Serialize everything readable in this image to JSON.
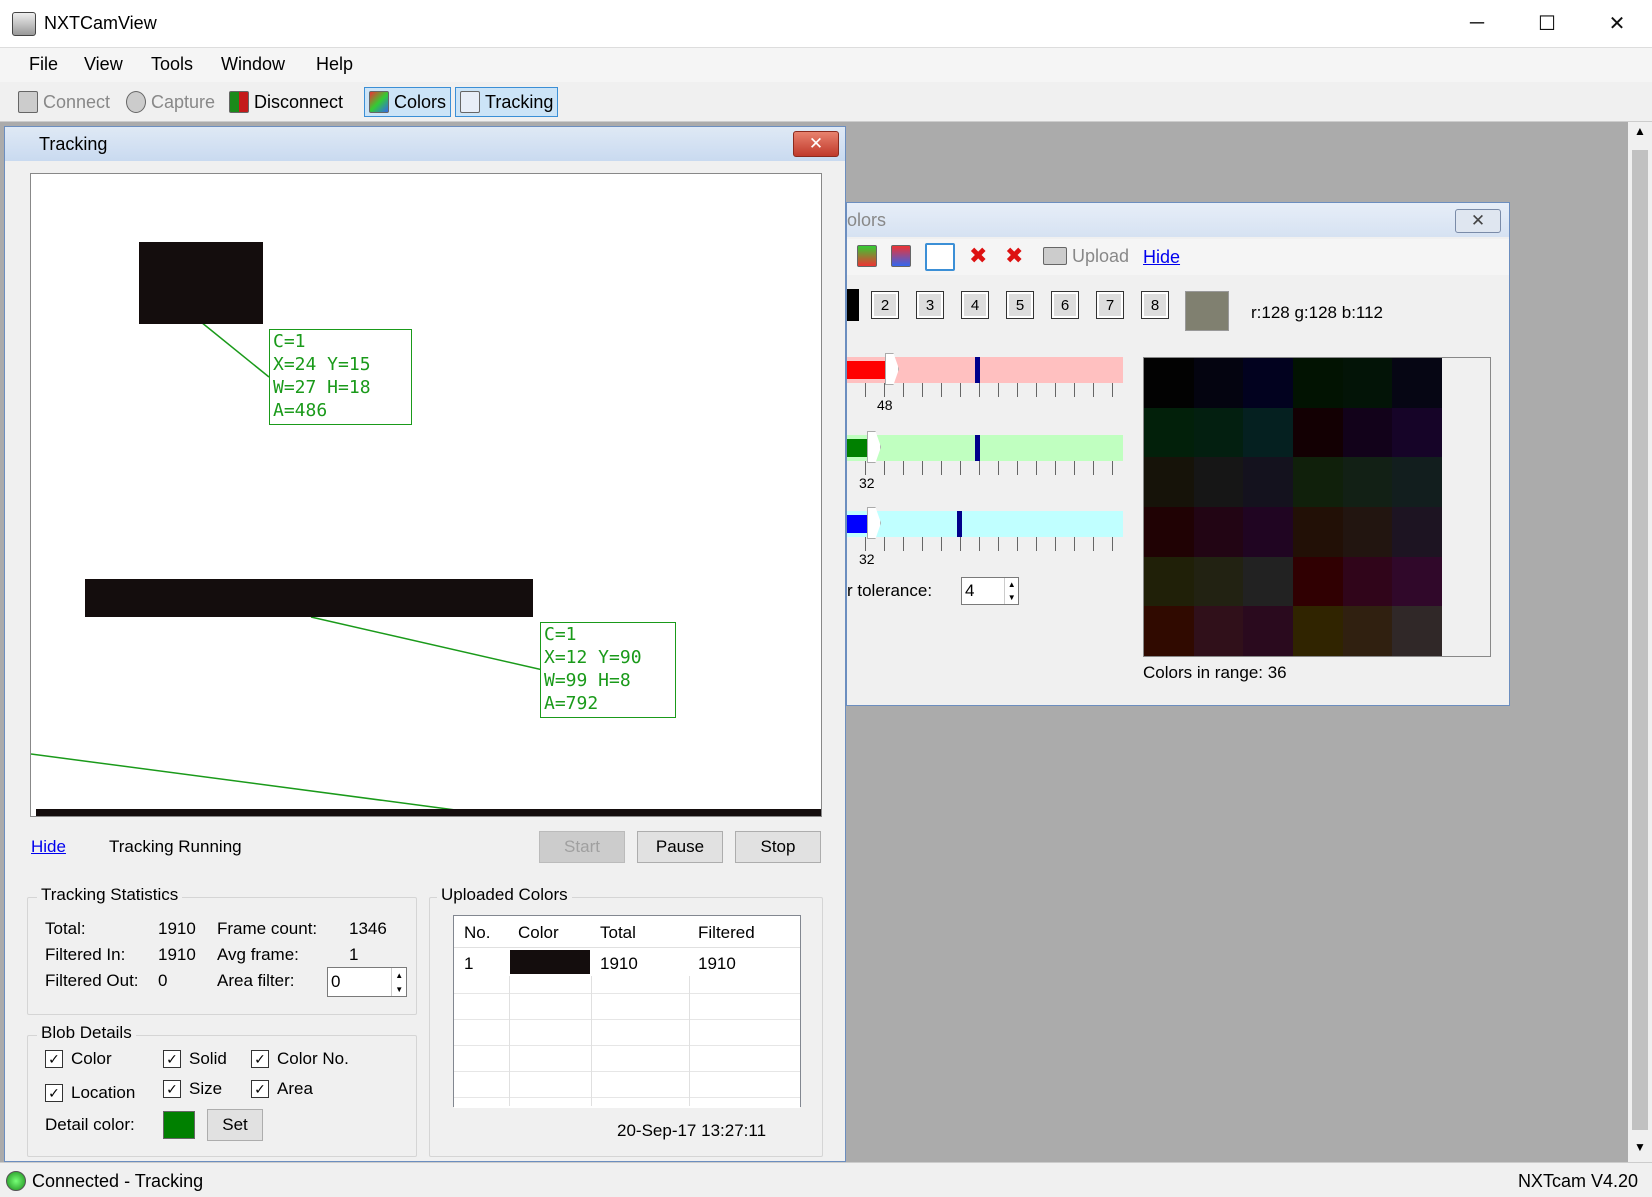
{
  "app": {
    "title": "NXTCamView"
  },
  "window_controls": {
    "minimize": "─",
    "maximize": "☐",
    "close": "✕"
  },
  "menu": [
    "File",
    "View",
    "Tools",
    "Window",
    "Help"
  ],
  "toolbar": {
    "connect": "Connect",
    "capture": "Capture",
    "disconnect": "Disconnect",
    "colors": "Colors",
    "tracking": "Tracking"
  },
  "tracking": {
    "title": "Tracking",
    "hide": "Hide",
    "status": "Tracking Running",
    "start": "Start",
    "pause": "Pause",
    "stop": "Stop",
    "blobs": [
      {
        "label": "C=1\nX=24 Y=15\nW=27 H=18\nA=486"
      },
      {
        "label": "C=1\nX=12 Y=90\nW=99 H=8\nA=792"
      }
    ],
    "stats": {
      "title": "Tracking Statistics",
      "total_label": "Total:",
      "total": "1910",
      "filtered_in_label": "Filtered In:",
      "filtered_in": "1910",
      "filtered_out_label": "Filtered Out:",
      "filtered_out": "0",
      "frame_count_label": "Frame count:",
      "frame_count": "1346",
      "avg_frame_label": "Avg frame:",
      "avg_frame": "1",
      "area_filter_label": "Area filter:",
      "area_filter": "0"
    },
    "blob_details": {
      "title": "Blob Details",
      "color": "Color",
      "solid": "Solid",
      "color_no": "Color No.",
      "location": "Location",
      "size": "Size",
      "area": "Area",
      "detail_color_label": "Detail color:",
      "detail_color": "#008000",
      "set": "Set"
    },
    "uploaded": {
      "title": "Uploaded Colors",
      "headers": [
        "No.",
        "Color",
        "Total",
        "Filtered"
      ],
      "rows": [
        {
          "no": "1",
          "color": "#140d0d",
          "total": "1910",
          "filtered": "1910"
        }
      ],
      "timestamp": "20-Sep-17 13:27:11"
    }
  },
  "colors": {
    "title": "olors",
    "upload": "Upload",
    "hide": "Hide",
    "slots": [
      "2",
      "3",
      "4",
      "5",
      "6",
      "7",
      "8"
    ],
    "current_color": "#808070",
    "rgb_text": "r:128 g:128 b:112",
    "red_value": "48",
    "green_value": "32",
    "blue_value": "32",
    "tolerance_label": "r tolerance:",
    "tolerance": "4",
    "range_text": "Colors in range: 36"
  },
  "status": {
    "left": "Connected - Tracking",
    "right": "NXTcam V4.20"
  }
}
